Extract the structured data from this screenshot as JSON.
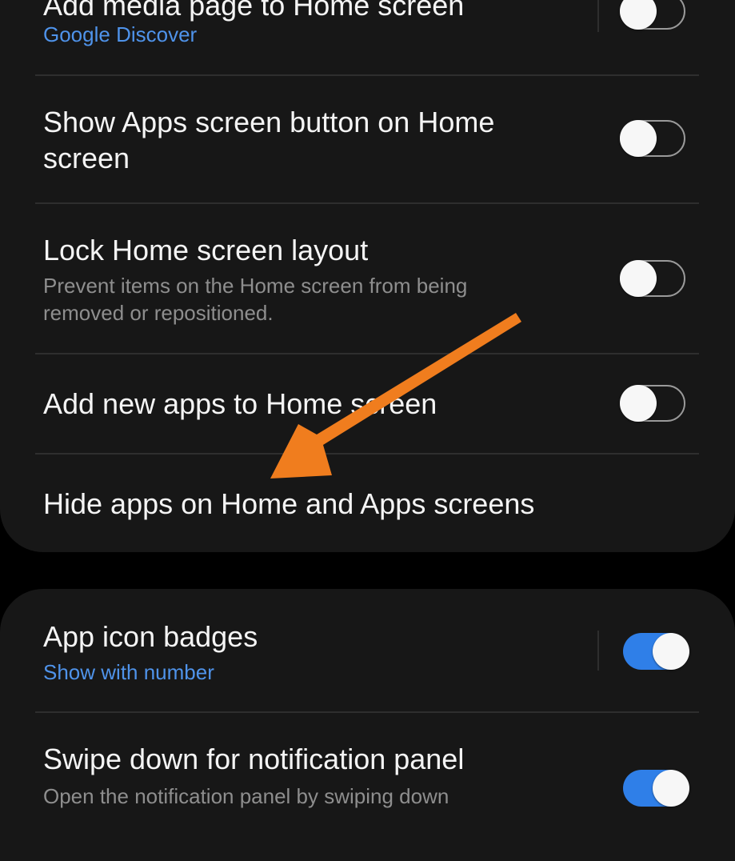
{
  "settings_group_1": {
    "items": [
      {
        "title": "Add media page to Home screen",
        "subtitle": "Google Discover",
        "toggle": "off"
      },
      {
        "title": "Show Apps screen button on Home screen",
        "toggle": "off"
      },
      {
        "title": "Lock Home screen layout",
        "subtitle": "Prevent items on the Home screen from being removed or repositioned.",
        "toggle": "off"
      },
      {
        "title": "Add new apps to Home screen",
        "toggle": "off"
      },
      {
        "title": "Hide apps on Home and Apps screens"
      }
    ]
  },
  "settings_group_2": {
    "items": [
      {
        "title": "App icon badges",
        "subtitle": "Show with number",
        "toggle": "on"
      },
      {
        "title": "Swipe down for notification panel",
        "subtitle": "Open the notification panel by swiping down",
        "toggle": "on"
      }
    ]
  },
  "colors": {
    "accent": "#2f7fe8",
    "link": "#4f93ea",
    "arrow_annotation": "#f07d1e",
    "card_background": "#171717"
  }
}
